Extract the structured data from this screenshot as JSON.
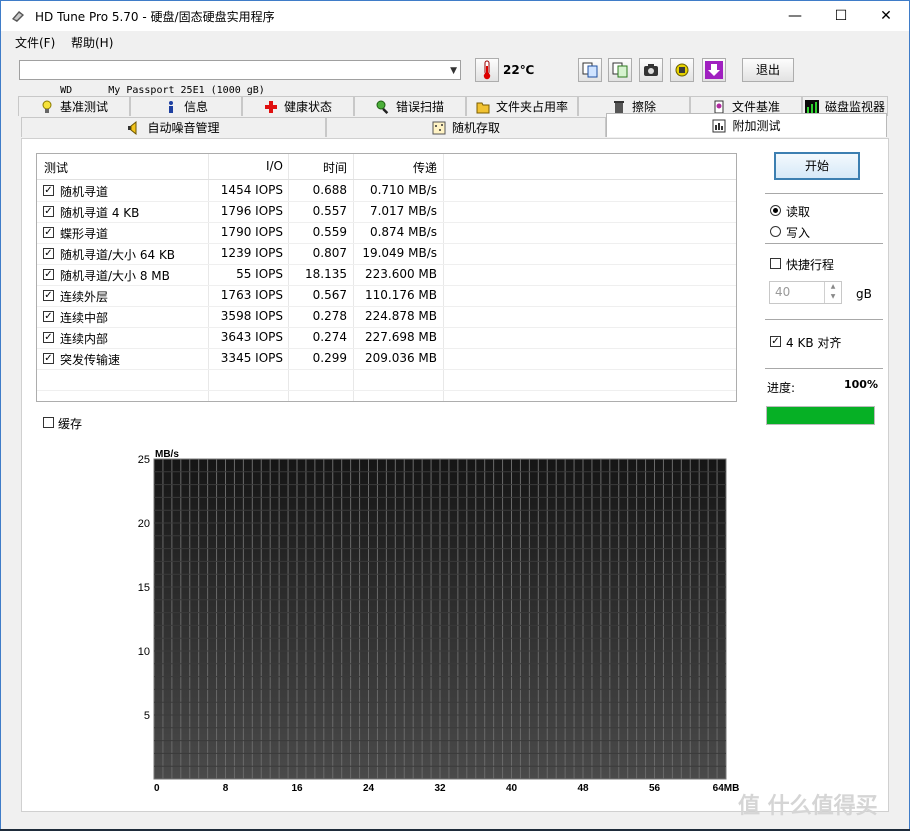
{
  "window": {
    "title": "HD Tune Pro 5.70 - 硬盘/固态硬盘实用程序",
    "minimize": "—",
    "maximize": "☐",
    "close": "✕"
  },
  "menu": [
    {
      "label": "文件(F)"
    },
    {
      "label": "帮助(H)"
    }
  ],
  "toolbar": {
    "drive": "WD      My Passport 25E1 (1000 gB)",
    "temperature": "22℃",
    "exit_label": "退出",
    "icons": [
      "copy-icon",
      "copy-text-icon",
      "camera-icon",
      "tools-icon",
      "download-icon"
    ]
  },
  "tabs_row1": [
    {
      "label": "基准测试",
      "icon": "lightbulb-icon"
    },
    {
      "label": "信息",
      "icon": "info-icon"
    },
    {
      "label": "健康状态",
      "icon": "health-cross-icon"
    },
    {
      "label": "错误扫描",
      "icon": "magnifier-icon"
    },
    {
      "label": "文件夹占用率",
      "icon": "folder-icon"
    },
    {
      "label": "擦除",
      "icon": "trash-icon"
    },
    {
      "label": "文件基准",
      "icon": "file-benchmark-icon"
    },
    {
      "label": "磁盘监视器",
      "icon": "monitor-chart-icon"
    }
  ],
  "tabs_row2": [
    {
      "label": "自动噪音管理",
      "icon": "speaker-icon"
    },
    {
      "label": "随机存取",
      "icon": "random-access-icon"
    },
    {
      "label": "附加测试",
      "icon": "extra-tests-icon",
      "active": true
    }
  ],
  "results": {
    "headers": [
      "测试",
      "I/O",
      "时间",
      "传递"
    ],
    "rows": [
      {
        "name": "随机寻道",
        "io": "1454 IOPS",
        "time": "0.688",
        "transfer": "0.710 MB/s",
        "checked": true
      },
      {
        "name": "随机寻道 4 KB",
        "io": "1796 IOPS",
        "time": "0.557",
        "transfer": "7.017 MB/s",
        "checked": true
      },
      {
        "name": "蝶形寻道",
        "io": "1790 IOPS",
        "time": "0.559",
        "transfer": "0.874 MB/s",
        "checked": true
      },
      {
        "name": "随机寻道/大小 64 KB",
        "io": "1239 IOPS",
        "time": "0.807",
        "transfer": "19.049 MB/s",
        "checked": true
      },
      {
        "name": "随机寻道/大小 8 MB",
        "io": "55 IOPS",
        "time": "18.135",
        "transfer": "223.600 MB",
        "checked": true
      },
      {
        "name": "连续外层",
        "io": "1763 IOPS",
        "time": "0.567",
        "transfer": "110.176 MB",
        "checked": true
      },
      {
        "name": "连续中部",
        "io": "3598 IOPS",
        "time": "0.278",
        "transfer": "224.878 MB",
        "checked": true
      },
      {
        "name": "连续内部",
        "io": "3643 IOPS",
        "time": "0.274",
        "transfer": "227.698 MB",
        "checked": true
      },
      {
        "name": "突发传输速",
        "io": "3345 IOPS",
        "time": "0.299",
        "transfer": "209.036 MB",
        "checked": true
      }
    ]
  },
  "cache": {
    "label": "缓存",
    "checked": false
  },
  "side": {
    "start_label": "开始",
    "read_label": "读取",
    "write_label": "写入",
    "mode": "read",
    "quick_label": "快捷行程",
    "quick_checked": false,
    "quick_value": "40",
    "quick_unit": "gB",
    "align_label": "4 KB 对齐",
    "align_checked": true,
    "progress_label": "进度:",
    "progress_text": "100%",
    "progress": 1.0,
    "progress_color": "#06b025"
  },
  "chart_data": {
    "type": "line",
    "ylabel": "MB/s",
    "ylim": [
      0,
      25
    ],
    "yticks": [
      5,
      10,
      15,
      20,
      25
    ],
    "xlim": [
      0,
      64
    ],
    "xticks": [
      "0",
      "8",
      "16",
      "24",
      "32",
      "40",
      "48",
      "56",
      "64MB"
    ],
    "series": [],
    "background": "#151515",
    "grid_color": "#6a6a6a",
    "grid": true
  },
  "watermark": "值 什么值得买"
}
